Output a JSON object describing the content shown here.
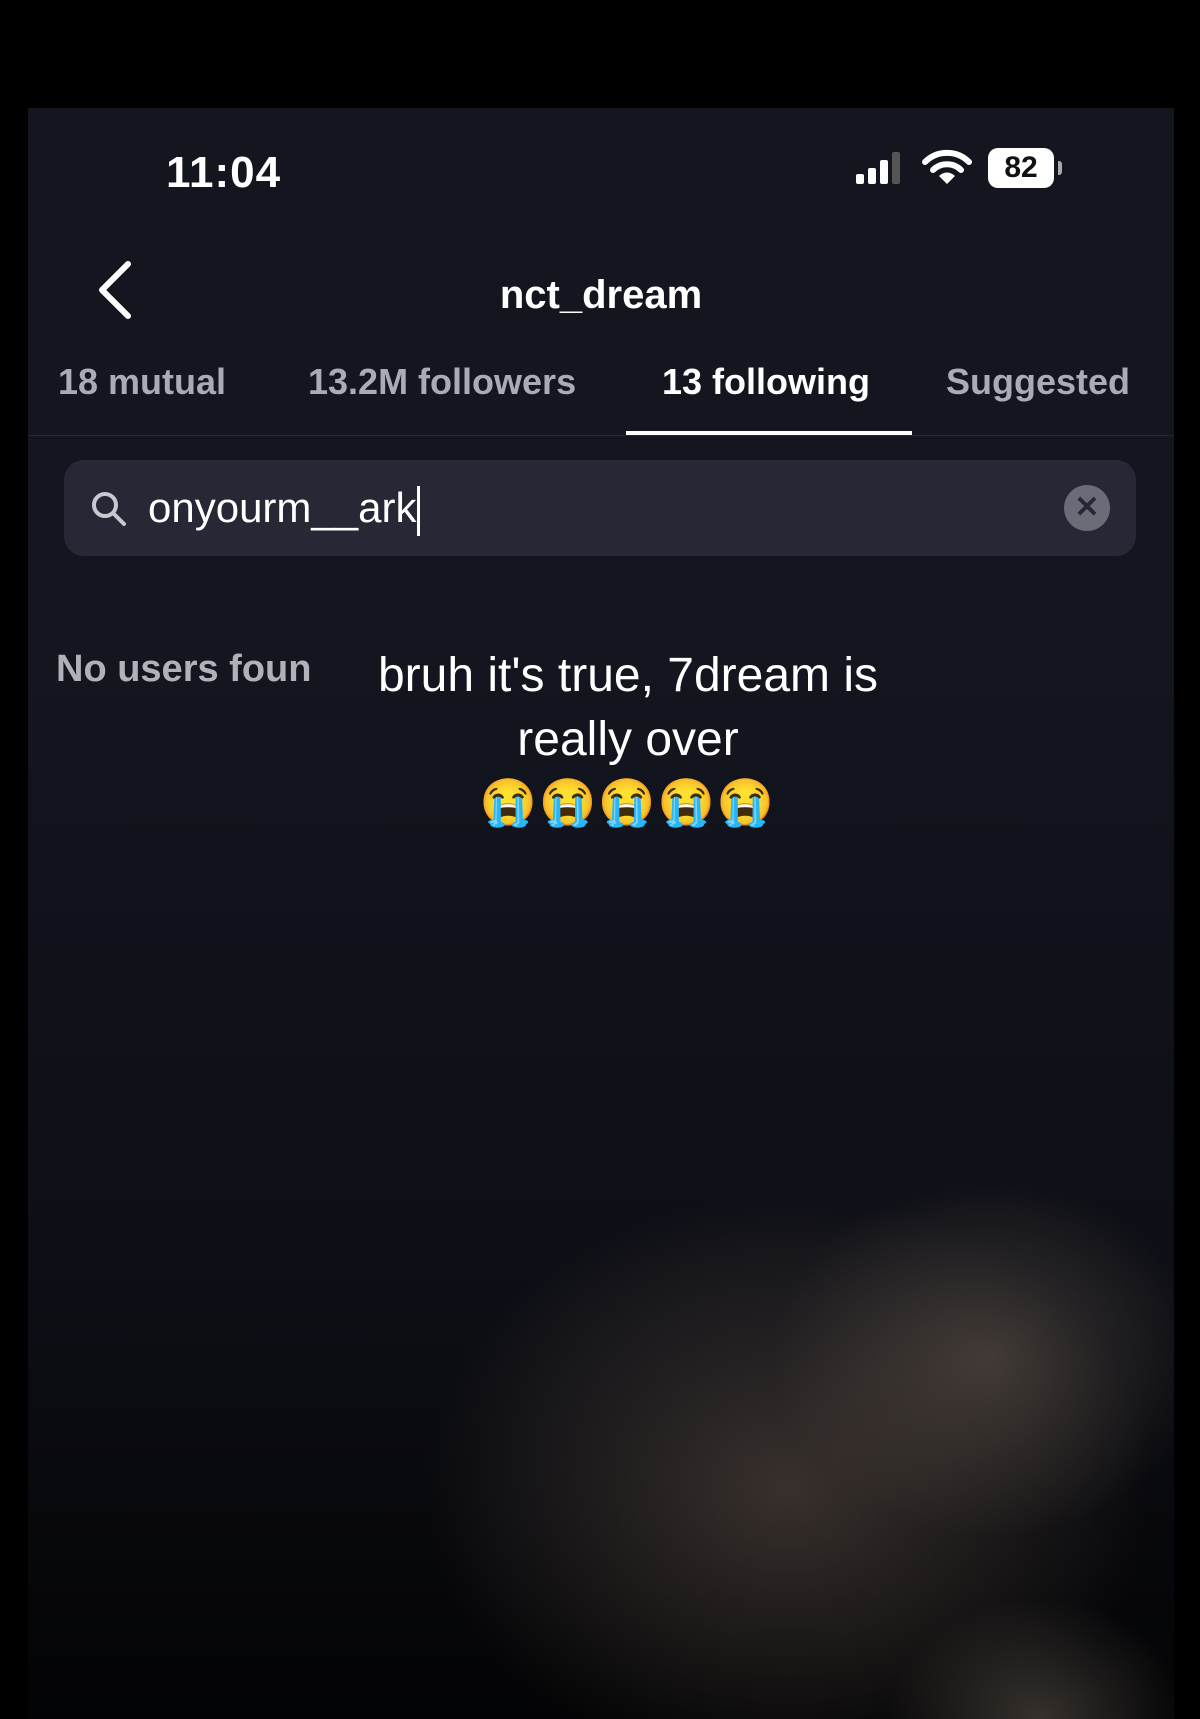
{
  "status_bar": {
    "time": "11:04",
    "battery": "82",
    "icons": [
      "cellular-signal-icon",
      "wifi-icon",
      "battery-icon"
    ]
  },
  "header": {
    "title": "nct_dream",
    "back_icon": "chevron-left-icon"
  },
  "tabs": [
    {
      "label": "18 mutual",
      "active": false
    },
    {
      "label": "13.2M followers",
      "active": false
    },
    {
      "label": "13 following",
      "active": true
    },
    {
      "label": "Suggested",
      "active": false
    }
  ],
  "search": {
    "value": "onyourm__ark",
    "icon": "search-icon",
    "clear_icon": "clear-icon"
  },
  "results": {
    "empty_text": "No users foun"
  },
  "overlay": {
    "caption": "bruh it's true, 7dream is really over",
    "emoji": "😭😭😭😭😭"
  },
  "colors": {
    "background": "#13151f",
    "search_bg": "#262935",
    "inactive_tab": "#a9abb5"
  }
}
